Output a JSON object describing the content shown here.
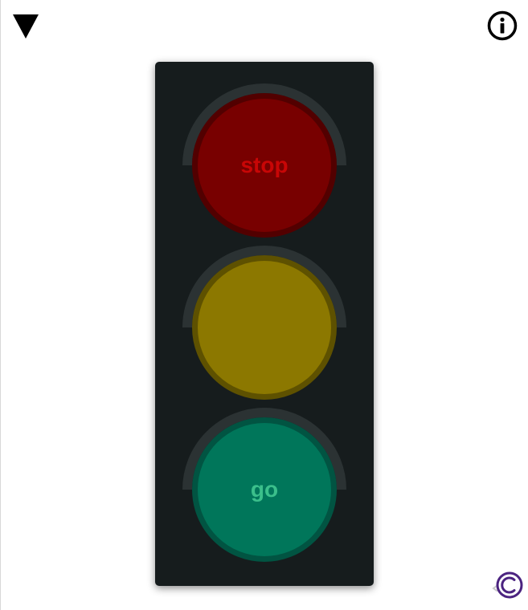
{
  "header": {
    "menu_icon": "triangle-down-icon",
    "info_icon": "info-circle-icon"
  },
  "traffic_light": {
    "red": {
      "label": "stop",
      "color": "#780000"
    },
    "amber": {
      "label": "",
      "color": "#8c7800"
    },
    "green": {
      "label": "go",
      "color": "#00765a"
    }
  },
  "footer": {
    "copyright_icon": "copyright-icon",
    "copyright_color": "#4b2380"
  }
}
